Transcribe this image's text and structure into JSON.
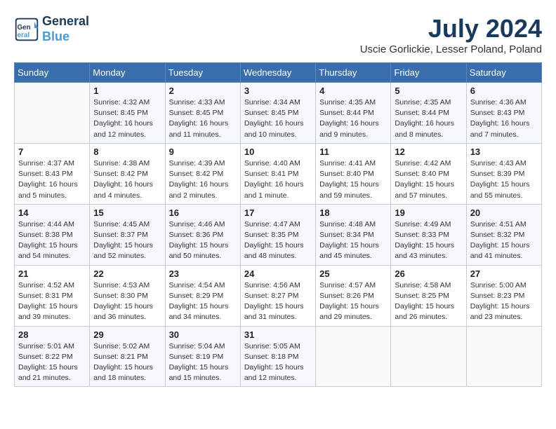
{
  "header": {
    "logo_line1": "General",
    "logo_line2": "Blue",
    "month_title": "July 2024",
    "location": "Uscie Gorlickie, Lesser Poland, Poland"
  },
  "days_of_week": [
    "Sunday",
    "Monday",
    "Tuesday",
    "Wednesday",
    "Thursday",
    "Friday",
    "Saturday"
  ],
  "weeks": [
    [
      {
        "day": "",
        "info": ""
      },
      {
        "day": "1",
        "info": "Sunrise: 4:32 AM\nSunset: 8:45 PM\nDaylight: 16 hours\nand 12 minutes."
      },
      {
        "day": "2",
        "info": "Sunrise: 4:33 AM\nSunset: 8:45 PM\nDaylight: 16 hours\nand 11 minutes."
      },
      {
        "day": "3",
        "info": "Sunrise: 4:34 AM\nSunset: 8:45 PM\nDaylight: 16 hours\nand 10 minutes."
      },
      {
        "day": "4",
        "info": "Sunrise: 4:35 AM\nSunset: 8:44 PM\nDaylight: 16 hours\nand 9 minutes."
      },
      {
        "day": "5",
        "info": "Sunrise: 4:35 AM\nSunset: 8:44 PM\nDaylight: 16 hours\nand 8 minutes."
      },
      {
        "day": "6",
        "info": "Sunrise: 4:36 AM\nSunset: 8:43 PM\nDaylight: 16 hours\nand 7 minutes."
      }
    ],
    [
      {
        "day": "7",
        "info": "Sunrise: 4:37 AM\nSunset: 8:43 PM\nDaylight: 16 hours\nand 5 minutes."
      },
      {
        "day": "8",
        "info": "Sunrise: 4:38 AM\nSunset: 8:42 PM\nDaylight: 16 hours\nand 4 minutes."
      },
      {
        "day": "9",
        "info": "Sunrise: 4:39 AM\nSunset: 8:42 PM\nDaylight: 16 hours\nand 2 minutes."
      },
      {
        "day": "10",
        "info": "Sunrise: 4:40 AM\nSunset: 8:41 PM\nDaylight: 16 hours\nand 1 minute."
      },
      {
        "day": "11",
        "info": "Sunrise: 4:41 AM\nSunset: 8:40 PM\nDaylight: 15 hours\nand 59 minutes."
      },
      {
        "day": "12",
        "info": "Sunrise: 4:42 AM\nSunset: 8:40 PM\nDaylight: 15 hours\nand 57 minutes."
      },
      {
        "day": "13",
        "info": "Sunrise: 4:43 AM\nSunset: 8:39 PM\nDaylight: 15 hours\nand 55 minutes."
      }
    ],
    [
      {
        "day": "14",
        "info": "Sunrise: 4:44 AM\nSunset: 8:38 PM\nDaylight: 15 hours\nand 54 minutes."
      },
      {
        "day": "15",
        "info": "Sunrise: 4:45 AM\nSunset: 8:37 PM\nDaylight: 15 hours\nand 52 minutes."
      },
      {
        "day": "16",
        "info": "Sunrise: 4:46 AM\nSunset: 8:36 PM\nDaylight: 15 hours\nand 50 minutes."
      },
      {
        "day": "17",
        "info": "Sunrise: 4:47 AM\nSunset: 8:35 PM\nDaylight: 15 hours\nand 48 minutes."
      },
      {
        "day": "18",
        "info": "Sunrise: 4:48 AM\nSunset: 8:34 PM\nDaylight: 15 hours\nand 45 minutes."
      },
      {
        "day": "19",
        "info": "Sunrise: 4:49 AM\nSunset: 8:33 PM\nDaylight: 15 hours\nand 43 minutes."
      },
      {
        "day": "20",
        "info": "Sunrise: 4:51 AM\nSunset: 8:32 PM\nDaylight: 15 hours\nand 41 minutes."
      }
    ],
    [
      {
        "day": "21",
        "info": "Sunrise: 4:52 AM\nSunset: 8:31 PM\nDaylight: 15 hours\nand 39 minutes."
      },
      {
        "day": "22",
        "info": "Sunrise: 4:53 AM\nSunset: 8:30 PM\nDaylight: 15 hours\nand 36 minutes."
      },
      {
        "day": "23",
        "info": "Sunrise: 4:54 AM\nSunset: 8:29 PM\nDaylight: 15 hours\nand 34 minutes."
      },
      {
        "day": "24",
        "info": "Sunrise: 4:56 AM\nSunset: 8:27 PM\nDaylight: 15 hours\nand 31 minutes."
      },
      {
        "day": "25",
        "info": "Sunrise: 4:57 AM\nSunset: 8:26 PM\nDaylight: 15 hours\nand 29 minutes."
      },
      {
        "day": "26",
        "info": "Sunrise: 4:58 AM\nSunset: 8:25 PM\nDaylight: 15 hours\nand 26 minutes."
      },
      {
        "day": "27",
        "info": "Sunrise: 5:00 AM\nSunset: 8:23 PM\nDaylight: 15 hours\nand 23 minutes."
      }
    ],
    [
      {
        "day": "28",
        "info": "Sunrise: 5:01 AM\nSunset: 8:22 PM\nDaylight: 15 hours\nand 21 minutes."
      },
      {
        "day": "29",
        "info": "Sunrise: 5:02 AM\nSunset: 8:21 PM\nDaylight: 15 hours\nand 18 minutes."
      },
      {
        "day": "30",
        "info": "Sunrise: 5:04 AM\nSunset: 8:19 PM\nDaylight: 15 hours\nand 15 minutes."
      },
      {
        "day": "31",
        "info": "Sunrise: 5:05 AM\nSunset: 8:18 PM\nDaylight: 15 hours\nand 12 minutes."
      },
      {
        "day": "",
        "info": ""
      },
      {
        "day": "",
        "info": ""
      },
      {
        "day": "",
        "info": ""
      }
    ]
  ]
}
